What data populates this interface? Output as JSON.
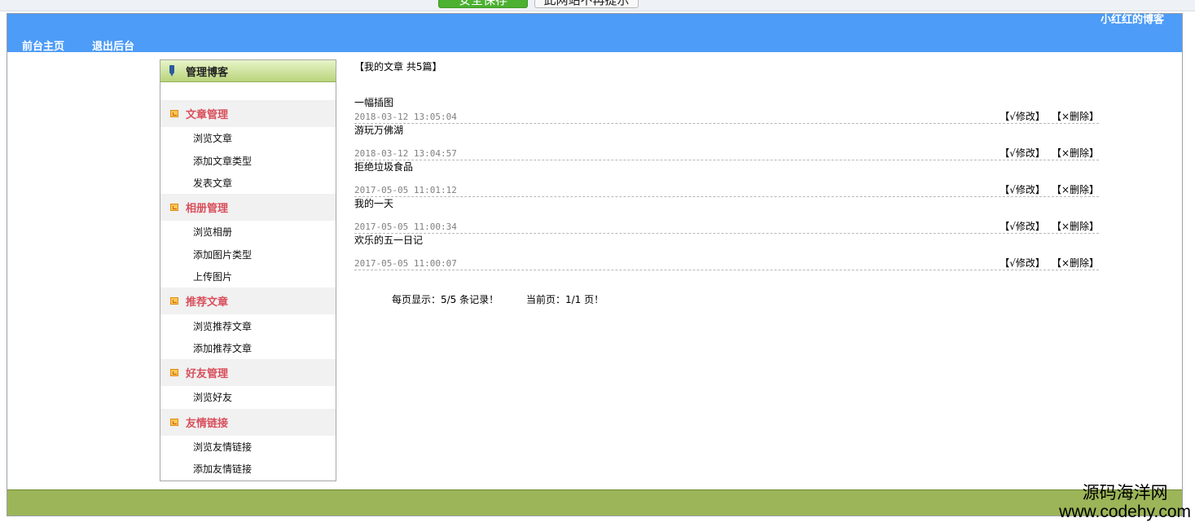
{
  "password_bar": {
    "save_label": "安全保存",
    "never_label": "此网站不再提示"
  },
  "header": {
    "owner_label": "小红红的博客",
    "nav": [
      {
        "label": "前台主页"
      },
      {
        "label": "退出后台"
      }
    ]
  },
  "sidebar": {
    "title": "管理博客",
    "groups": [
      {
        "label": "文章管理",
        "items": [
          {
            "label": "浏览文章"
          },
          {
            "label": "添加文章类型"
          },
          {
            "label": "发表文章"
          }
        ]
      },
      {
        "label": "相册管理",
        "items": [
          {
            "label": "浏览相册"
          },
          {
            "label": "添加图片类型"
          },
          {
            "label": "上传图片"
          }
        ]
      },
      {
        "label": "推荐文章",
        "items": [
          {
            "label": "浏览推荐文章"
          },
          {
            "label": "添加推荐文章"
          }
        ]
      },
      {
        "label": "好友管理",
        "items": [
          {
            "label": "浏览好友"
          }
        ]
      },
      {
        "label": "友情链接",
        "items": [
          {
            "label": "浏览友情链接"
          },
          {
            "label": "添加友情链接"
          }
        ]
      }
    ]
  },
  "content": {
    "title": "【我的文章 共5篇】",
    "edit_label": "【√修改】",
    "delete_label": "【×删除】",
    "articles": [
      {
        "title": "一幅插图",
        "date": "2018-03-12 13:05:04"
      },
      {
        "title": "游玩万佛湖",
        "date": "2018-03-12 13:04:57"
      },
      {
        "title": "拒绝垃圾食品",
        "date": "2017-05-05 11:01:12"
      },
      {
        "title": "我的一天",
        "date": "2017-05-05 11:00:34"
      },
      {
        "title": "欢乐的五一日记",
        "date": "2017-05-05 11:00:07"
      }
    ],
    "pager": {
      "per_page": "每页显示：5/5 条记录！",
      "current": "当前页：1/1 页！"
    }
  },
  "watermark": {
    "line1": "源码海洋网",
    "line2": "www.codehy.com"
  }
}
